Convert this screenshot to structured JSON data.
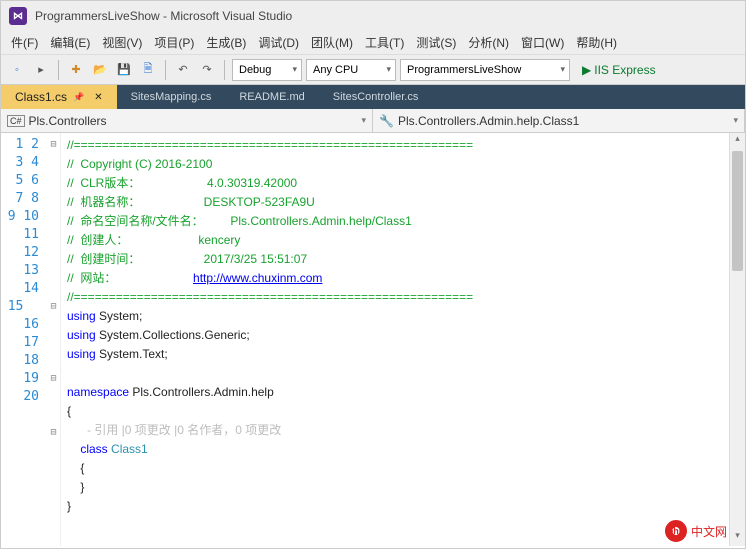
{
  "window": {
    "title": "ProgrammersLiveShow - Microsoft Visual Studio",
    "vs_glyph": "⋈"
  },
  "menu": {
    "file": "件(F)",
    "edit": "编辑(E)",
    "view": "视图(V)",
    "project": "项目(P)",
    "build": "生成(B)",
    "debug": "调试(D)",
    "team": "团队(M)",
    "tools": "工具(T)",
    "test": "测试(S)",
    "analyze": "分析(N)",
    "window": "窗口(W)",
    "help": "帮助(H)"
  },
  "toolbar": {
    "config": "Debug",
    "platform": "Any CPU",
    "startup": "ProgrammersLiveShow",
    "run": "IIS Express"
  },
  "tabs": [
    {
      "label": "Class1.cs",
      "active": true,
      "pinned": true
    },
    {
      "label": "SitesMapping.cs",
      "active": false
    },
    {
      "label": "README.md",
      "active": false
    },
    {
      "label": "SitesController.cs",
      "active": false
    }
  ],
  "nav": {
    "left_icon": "C#",
    "left": "Pls.Controllers",
    "right_icon": "🔧",
    "right": "Pls.Controllers.Admin.help.Class1"
  },
  "code": {
    "lines": [
      {
        "n": 1,
        "fold": "⊟",
        "seg": [
          {
            "t": "//=========================================================",
            "c": "c-comment"
          }
        ]
      },
      {
        "n": 2,
        "fold": "",
        "seg": [
          {
            "t": "//  Copyright (C) 2016-2100",
            "c": "c-comment"
          }
        ]
      },
      {
        "n": 3,
        "fold": "",
        "seg": [
          {
            "t": "//  CLR版本：                    4.0.30319.42000",
            "c": "c-comment"
          }
        ]
      },
      {
        "n": 4,
        "fold": "",
        "seg": [
          {
            "t": "//  机器名称：                   DESKTOP-523FA9U",
            "c": "c-comment"
          }
        ]
      },
      {
        "n": 5,
        "fold": "",
        "seg": [
          {
            "t": "//  命名空间名称/文件名：        Pls.Controllers.Admin.help/Class1",
            "c": "c-comment"
          }
        ]
      },
      {
        "n": 6,
        "fold": "",
        "seg": [
          {
            "t": "//  创建人：                     kencery",
            "c": "c-comment"
          }
        ]
      },
      {
        "n": 7,
        "fold": "",
        "seg": [
          {
            "t": "//  创建时间：                   2017/3/25 15:51:07",
            "c": "c-comment"
          }
        ]
      },
      {
        "n": 8,
        "fold": "",
        "seg": [
          {
            "t": "//  网站：                       ",
            "c": "c-comment"
          },
          {
            "t": "http://www.chuxinm.com",
            "c": "c-link"
          }
        ]
      },
      {
        "n": 9,
        "fold": "",
        "seg": [
          {
            "t": "//=========================================================",
            "c": "c-comment"
          }
        ]
      },
      {
        "n": 10,
        "fold": "⊟",
        "seg": [
          {
            "t": "using",
            "c": "c-key"
          },
          {
            "t": " System;",
            "c": ""
          }
        ]
      },
      {
        "n": 11,
        "fold": "",
        "seg": [
          {
            "t": "using",
            "c": "c-key"
          },
          {
            "t": " System.Collections.Generic;",
            "c": ""
          }
        ]
      },
      {
        "n": 12,
        "fold": "",
        "seg": [
          {
            "t": "using",
            "c": "c-key"
          },
          {
            "t": " System.Text;",
            "c": ""
          }
        ]
      },
      {
        "n": 13,
        "fold": "",
        "seg": [
          {
            "t": "",
            "c": ""
          }
        ]
      },
      {
        "n": 14,
        "fold": "⊟",
        "seg": [
          {
            "t": "namespace",
            "c": "c-key"
          },
          {
            "t": " Pls.Controllers.Admin.help",
            "c": ""
          }
        ]
      },
      {
        "n": 15,
        "fold": "",
        "seg": [
          {
            "t": "{",
            "c": ""
          }
        ]
      },
      {
        "n": "",
        "fold": "",
        "seg": [
          {
            "t": "      - 引用 |0 项更改 |0 名作者，0 项更改",
            "c": "c-ghost"
          }
        ]
      },
      {
        "n": 16,
        "fold": "⊟",
        "seg": [
          {
            "t": "    ",
            "c": ""
          },
          {
            "t": "class",
            "c": "c-key"
          },
          {
            "t": " ",
            "c": ""
          },
          {
            "t": "Class1",
            "c": "c-type"
          }
        ]
      },
      {
        "n": 17,
        "fold": "",
        "seg": [
          {
            "t": "    {",
            "c": ""
          }
        ]
      },
      {
        "n": 18,
        "fold": "",
        "seg": [
          {
            "t": "    }",
            "c": ""
          }
        ]
      },
      {
        "n": 19,
        "fold": "",
        "seg": [
          {
            "t": "}",
            "c": ""
          }
        ]
      },
      {
        "n": 20,
        "fold": "",
        "seg": [
          {
            "t": "",
            "c": ""
          }
        ]
      }
    ]
  },
  "watermark": {
    "logo": "php",
    "text": "中文网"
  }
}
